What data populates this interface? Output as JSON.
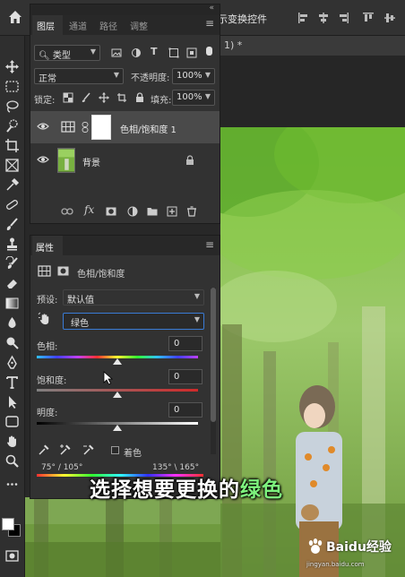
{
  "topbar": {
    "options_label": "显示变换控件"
  },
  "document_tab": {
    "title": "1) *"
  },
  "layers_panel": {
    "tabs": [
      "图层",
      "通道",
      "路径",
      "调整"
    ],
    "filter_kind": "类型",
    "blend_mode": "正常",
    "opacity_label": "不透明度:",
    "opacity_value": "100%",
    "lock_label": "锁定:",
    "fill_label": "填充:",
    "fill_value": "100%",
    "layers": [
      {
        "name": "色相/饱和度 1",
        "type": "adjustment",
        "selected": true
      },
      {
        "name": "背景",
        "type": "image",
        "selected": false
      }
    ]
  },
  "properties_panel": {
    "tab": "属性",
    "type_label": "色相/饱和度",
    "preset_label": "预设:",
    "preset_value": "默认值",
    "channel_value": "绿色",
    "hue_label": "色相:",
    "hue_value": "0",
    "hue_level": 0.5,
    "saturation_label": "饱和度:",
    "saturation_value": "0",
    "saturation_level": 0.5,
    "lightness_label": "明度:",
    "lightness_value": "0",
    "lightness_level": 0.5,
    "colorize_label": "着色",
    "range_left": "75° / 105°",
    "range_right": "135° \\ 165°"
  },
  "caption": {
    "prefix": "选择想要更换的",
    "highlight": "绿色"
  },
  "watermark": {
    "brand": "Baidu经验",
    "url": "jingyan.baidu.com"
  },
  "colors": {
    "panel_bg": "#323232",
    "app_bg": "#282828",
    "highlight_green": "#7df27d",
    "selected_row": "#4a4a4a"
  }
}
